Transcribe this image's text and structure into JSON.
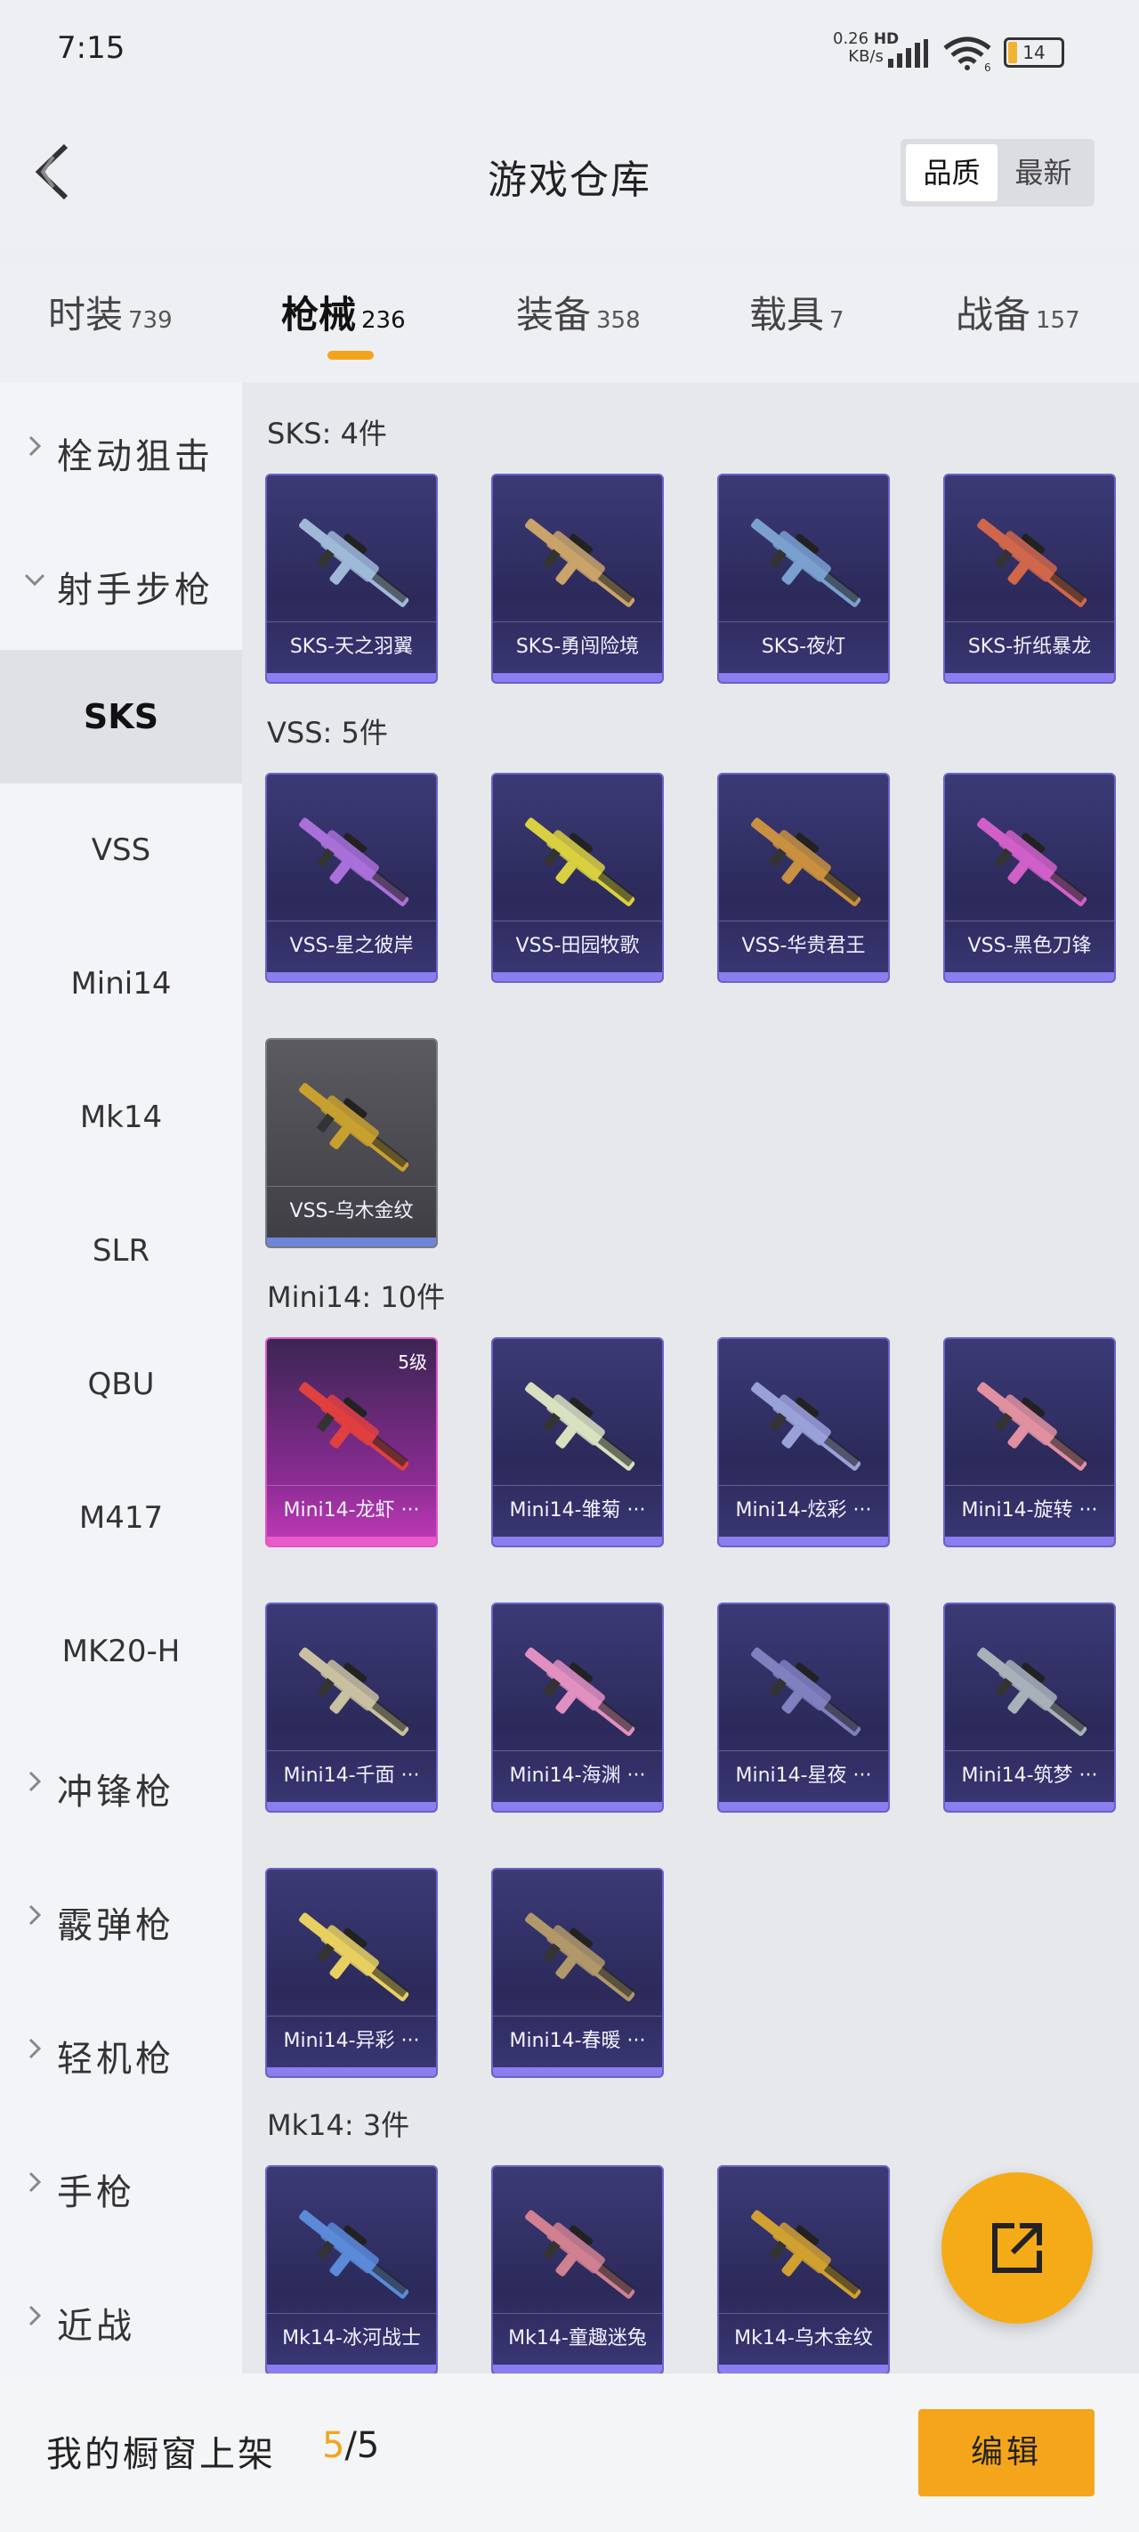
{
  "status_bar": {
    "time": "7:15",
    "net_speed": "0.26",
    "net_unit": "KB/s",
    "hd": "HD",
    "wifi_badge": "6",
    "battery": "14"
  },
  "header": {
    "title": "游戏仓库",
    "sort_quality": "品质",
    "sort_newest": "最新"
  },
  "tabs": [
    {
      "label": "时装",
      "count": "739"
    },
    {
      "label": "枪械",
      "count": "236"
    },
    {
      "label": "装备",
      "count": "358"
    },
    {
      "label": "载具",
      "count": "7"
    },
    {
      "label": "战备",
      "count": "157"
    }
  ],
  "sidebar": {
    "bolt_sniper": "栓动狙击",
    "marksman": "射手步枪",
    "subs": [
      "SKS",
      "VSS",
      "Mini14",
      "Mk14",
      "SLR",
      "QBU",
      "M417",
      "MK20-H"
    ],
    "smg": "冲锋枪",
    "shotgun": "霰弹枪",
    "lmg": "轻机枪",
    "pistol": "手枪",
    "melee": "近战"
  },
  "sections": {
    "sks": "SKS: 4件",
    "vss": "VSS: 5件",
    "mini14": "Mini14: 10件",
    "mk14": "Mk14: 3件"
  },
  "cards": {
    "sks": [
      "SKS-天之羽翼",
      "SKS-勇闯险境",
      "SKS-夜灯",
      "SKS-折纸暴龙"
    ],
    "vss": [
      "VSS-星之彼岸",
      "VSS-田园牧歌",
      "VSS-华贵君王",
      "VSS-黑色刀锋",
      "VSS-乌木金纹"
    ],
    "mini14": [
      "Mini14-龙虾 ···",
      "Mini14-雏菊 ···",
      "Mini14-炫彩 ···",
      "Mini14-旋转 ···",
      "Mini14-千面 ···",
      "Mini14-海渊 ···",
      "Mini14-星夜 ···",
      "Mini14-筑梦 ···",
      "Mini14-异彩 ···",
      "Mini14-春暖 ···"
    ],
    "mk14": [
      "Mk14-冰河战士",
      "Mk14-童趣迷兔",
      "Mk14-乌木金纹"
    ],
    "level_badge": "5级"
  },
  "bottom": {
    "label": "我的橱窗上架",
    "current": "5",
    "total": "/5",
    "edit": "编辑"
  },
  "colors": {
    "accent": "#f5a51c",
    "card_bg": "#2c2a5a",
    "card_bar": "#8a7ef0",
    "legendary": "#e055c8"
  }
}
